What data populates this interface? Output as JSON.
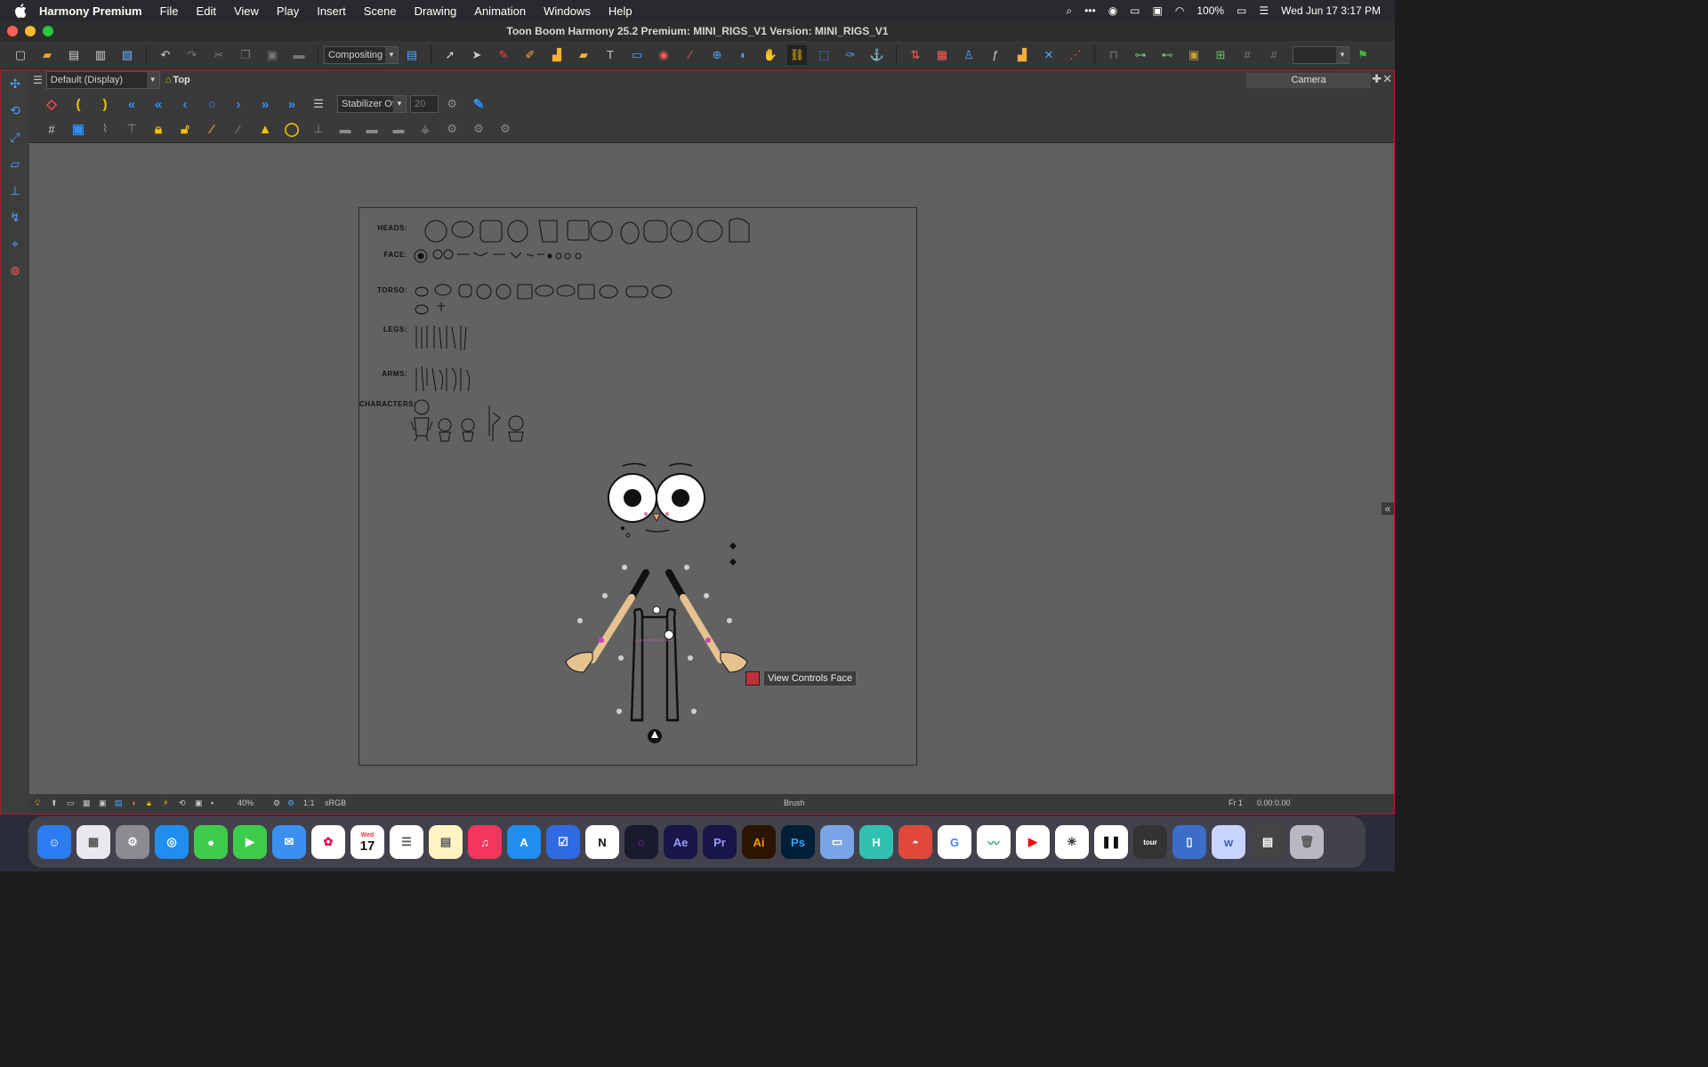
{
  "menubar": {
    "app": "Harmony Premium",
    "items": [
      "File",
      "Edit",
      "View",
      "Play",
      "Insert",
      "Scene",
      "Drawing",
      "Animation",
      "Windows",
      "Help"
    ],
    "battery": "100%",
    "datetime": "Wed Jun 17  3:17 PM"
  },
  "window": {
    "title": "Toon Boom Harmony 25.2 Premium: MINI_RIGS_V1 Version: MINI_RIGS_V1"
  },
  "toolbar": {
    "workspace_combo": "Compositing"
  },
  "view": {
    "display_combo": "Default (Display)",
    "view_mode": "Top",
    "camera_tab": "Camera",
    "stabilizer_combo": "Stabilizer Off",
    "stabilizer_value": "20"
  },
  "stage": {
    "rows": [
      "HEADS:",
      "FACE:",
      "TORSO:",
      "LEGS:",
      "ARMS:",
      "CHARACTERS:"
    ],
    "tooltip": "View Controls Face"
  },
  "statusbar": {
    "zoom": "40%",
    "ratio": "1:1",
    "colorspace": "sRGB",
    "tool": "Brush",
    "frame": "Fr 1",
    "timecode": "0.00:0.00"
  },
  "dock": {
    "calendar_month": "Wed",
    "calendar_day": "17",
    "apps": [
      "Finder",
      "Launchpad",
      "System Settings",
      "Safari",
      "Messages",
      "FaceTime",
      "Mail",
      "Photos",
      "Calendar",
      "Reminders",
      "Notes",
      "Music",
      "App Store",
      "Things",
      "Notion",
      "Arc",
      "After Effects",
      "Premiere",
      "Illustrator",
      "Photoshop",
      "Preview",
      "Harmony",
      "Asana",
      "Google",
      "Stocks",
      "YouTube",
      "Perplexity",
      "Pause",
      "TourBox",
      "Files",
      "Word",
      "Monitor",
      "Trash"
    ]
  },
  "colors": {
    "accent_red": "#b01e2a",
    "tool_blue": "#2f8fff",
    "skin": "#e6c28f"
  }
}
